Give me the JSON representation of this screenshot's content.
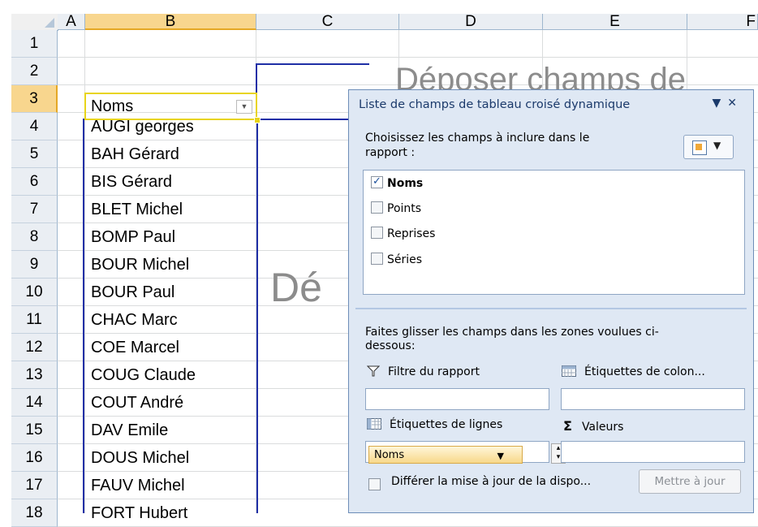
{
  "columns": [
    "A",
    "B",
    "C",
    "D",
    "E",
    "F"
  ],
  "rows": [
    "1",
    "2",
    "3",
    "4",
    "5",
    "6",
    "7",
    "8",
    "9",
    "10",
    "11",
    "12",
    "13",
    "14",
    "15",
    "16",
    "17",
    "18"
  ],
  "names": {
    "header": "Noms",
    "values": [
      "AUGI georges",
      "BAH Gérard",
      "BIS Gérard",
      "BLET Michel",
      "BOMP Paul",
      "BOUR Michel",
      "BOUR Paul",
      "CHAC Marc",
      "COE Marcel",
      "COUG Claude",
      "COUT André",
      "DAV Emile",
      "DOUS Michel",
      "FAUV Michel",
      "FORT Hubert"
    ]
  },
  "pivot_placeholder": {
    "drop_text_top": "Déposer champs de",
    "drop_text_mid": "Dé"
  },
  "panel": {
    "title": "Liste de champs de tableau croisé dynamique",
    "controls": "▼ ✕",
    "choose_text": "Choisissez les champs à inclure dans le rapport :",
    "fields": [
      {
        "label": "Noms",
        "checked": true
      },
      {
        "label": "Points",
        "checked": false
      },
      {
        "label": "Reprises",
        "checked": false
      },
      {
        "label": "Séries",
        "checked": false
      }
    ],
    "instruction": "Faites glisser les champs dans les zones voulues ci-dessous:",
    "zones": {
      "filter": "Filtre du rapport",
      "columns": "Étiquettes de colon...",
      "rows": "Étiquettes de lignes",
      "values": "Valeurs"
    },
    "row_item": "Noms",
    "defer_label": "Différer la mise à jour de la dispo...",
    "update_button": "Mettre à jour"
  },
  "colors": {
    "header_bg": "#eaeef3",
    "selected_header": "#f8d68e",
    "pivot_border": "#1f2fa6",
    "panel_bg": "#dfe8f4"
  }
}
